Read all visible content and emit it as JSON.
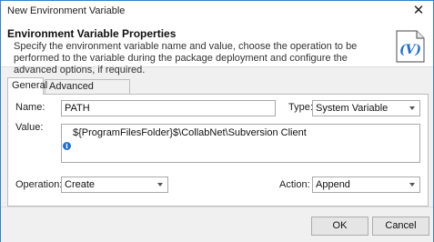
{
  "window": {
    "title": "New Environment Variable",
    "close_glyph": "✕"
  },
  "header": {
    "title": "Environment Variable Properties",
    "description": "Specify the environment variable name and value, choose the operation to be performed to the variable during the package deployment and configure the advanced options, if required.",
    "icon": "variable-document-icon",
    "icon_glyph": "(V)"
  },
  "tabs": [
    {
      "label": "General",
      "active": true
    },
    {
      "label": "Advanced Options",
      "active": false
    }
  ],
  "form": {
    "name_label": "Name:",
    "name_value": "PATH",
    "type_label": "Type:",
    "type_value": "System Variable",
    "value_label": "Value:",
    "value_text": "${ProgramFilesFolder}$\\CollabNet\\Subversion Client",
    "info_glyph": "i",
    "operation_label": "Operation:",
    "operation_value": "Create",
    "action_label": "Action:",
    "action_value": "Append"
  },
  "buttons": {
    "ok": "OK",
    "cancel": "Cancel"
  },
  "colors": {
    "accent_border": "#2f83d1",
    "icon_blue": "#1d6fd1"
  }
}
